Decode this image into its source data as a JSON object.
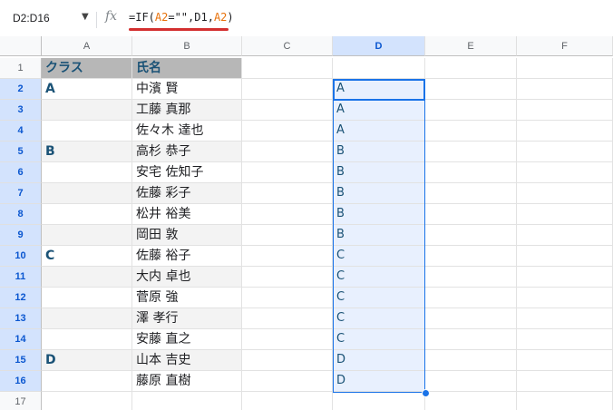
{
  "formula_bar": {
    "name_box": "D2:D16",
    "fx": "fx",
    "formula_parts": [
      "=IF(",
      "A2",
      "=\"\",D1,",
      "A2",
      ")"
    ]
  },
  "columns": [
    "A",
    "B",
    "C",
    "D",
    "E",
    "F"
  ],
  "selected_column": "D",
  "rows": [
    {
      "n": "1",
      "a": "クラス",
      "b": "氏名",
      "d": ""
    },
    {
      "n": "2",
      "a": "A",
      "b": "中濱 賢",
      "d": "A"
    },
    {
      "n": "3",
      "a": "",
      "b": "工藤 真那",
      "d": "A"
    },
    {
      "n": "4",
      "a": "",
      "b": "佐々木 達也",
      "d": "A"
    },
    {
      "n": "5",
      "a": "B",
      "b": "高杉 恭子",
      "d": "B"
    },
    {
      "n": "6",
      "a": "",
      "b": "安宅 佐知子",
      "d": "B"
    },
    {
      "n": "7",
      "a": "",
      "b": "佐藤 彩子",
      "d": "B"
    },
    {
      "n": "8",
      "a": "",
      "b": "松井 裕美",
      "d": "B"
    },
    {
      "n": "9",
      "a": "",
      "b": "岡田 敦",
      "d": "B"
    },
    {
      "n": "10",
      "a": "C",
      "b": "佐藤 裕子",
      "d": "C"
    },
    {
      "n": "11",
      "a": "",
      "b": "大内 卓也",
      "d": "C"
    },
    {
      "n": "12",
      "a": "",
      "b": "菅原 強",
      "d": "C"
    },
    {
      "n": "13",
      "a": "",
      "b": "澤 孝行",
      "d": "C"
    },
    {
      "n": "14",
      "a": "",
      "b": "安藤 直之",
      "d": "C"
    },
    {
      "n": "15",
      "a": "D",
      "b": "山本 吉史",
      "d": "D"
    },
    {
      "n": "16",
      "a": "",
      "b": "藤原 直樹",
      "d": "D"
    },
    {
      "n": "17",
      "a": "",
      "b": "",
      "d": ""
    }
  ]
}
